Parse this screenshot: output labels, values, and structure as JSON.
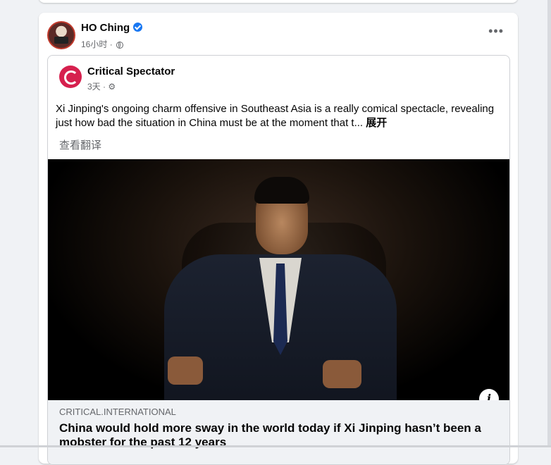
{
  "post": {
    "author": "HO Ching",
    "time": "16小时",
    "separator": "·"
  },
  "shared": {
    "page_name": "Critical Spectator",
    "time": "3天",
    "separator": "·",
    "body": "Xi Jinping's ongoing charm offensive in Southeast Asia is a really comical spectacle, revealing just how bad the situation in China must be at the moment that t...",
    "see_more": "展开",
    "translate": "查看翻译",
    "info_icon": "i",
    "link": {
      "domain": "CRITICAL.INTERNATIONAL",
      "title": "China would hold more sway in the world today if Xi Jinping hasn’t been a mobster for the past 12 years"
    }
  },
  "icons": {
    "verified": "verified-badge-icon",
    "globe": "globe-icon",
    "gear": "gear-icon",
    "more": "more-options-icon",
    "info": "info-icon"
  },
  "colors": {
    "accent": "#1877f2",
    "page_logo": "#d6204e",
    "background": "#f0f2f5"
  }
}
